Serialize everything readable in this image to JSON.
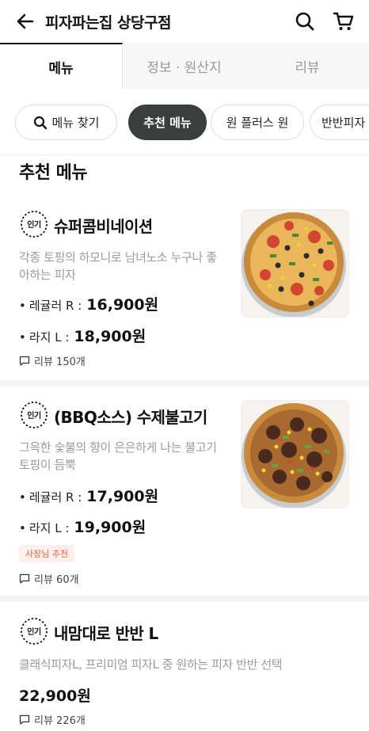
{
  "header": {
    "title": "피자파는집 상당구점",
    "back_icon": "arrow-left-icon",
    "search_icon": "search-icon",
    "cart_icon": "cart-icon"
  },
  "tabs": [
    {
      "label": "메뉴",
      "active": true
    },
    {
      "label": "정보 · 원산지",
      "active": false
    },
    {
      "label": "리뷰",
      "active": false
    }
  ],
  "chips": {
    "search": "메뉴 찾기",
    "items": [
      "추천 메뉴",
      "원 플러스 원",
      "반반피자"
    ],
    "active": "추천 메뉴"
  },
  "section_title": "추천 메뉴",
  "items": [
    {
      "badge": "인기",
      "name": "슈퍼콤비네이션",
      "description": "각종 토핑의 하모니로 남녀노소 누구나 좋아하는 피자",
      "prices": [
        {
          "label": "레귤러 R :",
          "price": "16,900원"
        },
        {
          "label": "라지 L :",
          "price": "18,900원"
        }
      ],
      "review": "리뷰 150개"
    },
    {
      "badge": "인기",
      "name": "(BBQ소스) 수제불고기",
      "description": "그윽한 숯불의 향이 은은하게 나는 불고기 토핑이 듬뿍",
      "prices": [
        {
          "label": "레귤러 R :",
          "price": "17,900원"
        },
        {
          "label": "라지 L :",
          "price": "19,900원"
        }
      ],
      "owner_badge": "사장님 추천",
      "review": "리뷰 60개"
    },
    {
      "badge": "인기",
      "name": "내맘대로 반반 L",
      "description": "클래식피자L, 프리미엄 피자L 중 원하는 피자 반반 선택",
      "price": "22,900원",
      "review": "리뷰 226개"
    }
  ],
  "colors": {
    "active_chip_bg": "#3a3f3e",
    "owner_badge_text": "#e2643f",
    "owner_badge_bg": "#fdf0ec",
    "muted_text": "#9a9a9a"
  }
}
